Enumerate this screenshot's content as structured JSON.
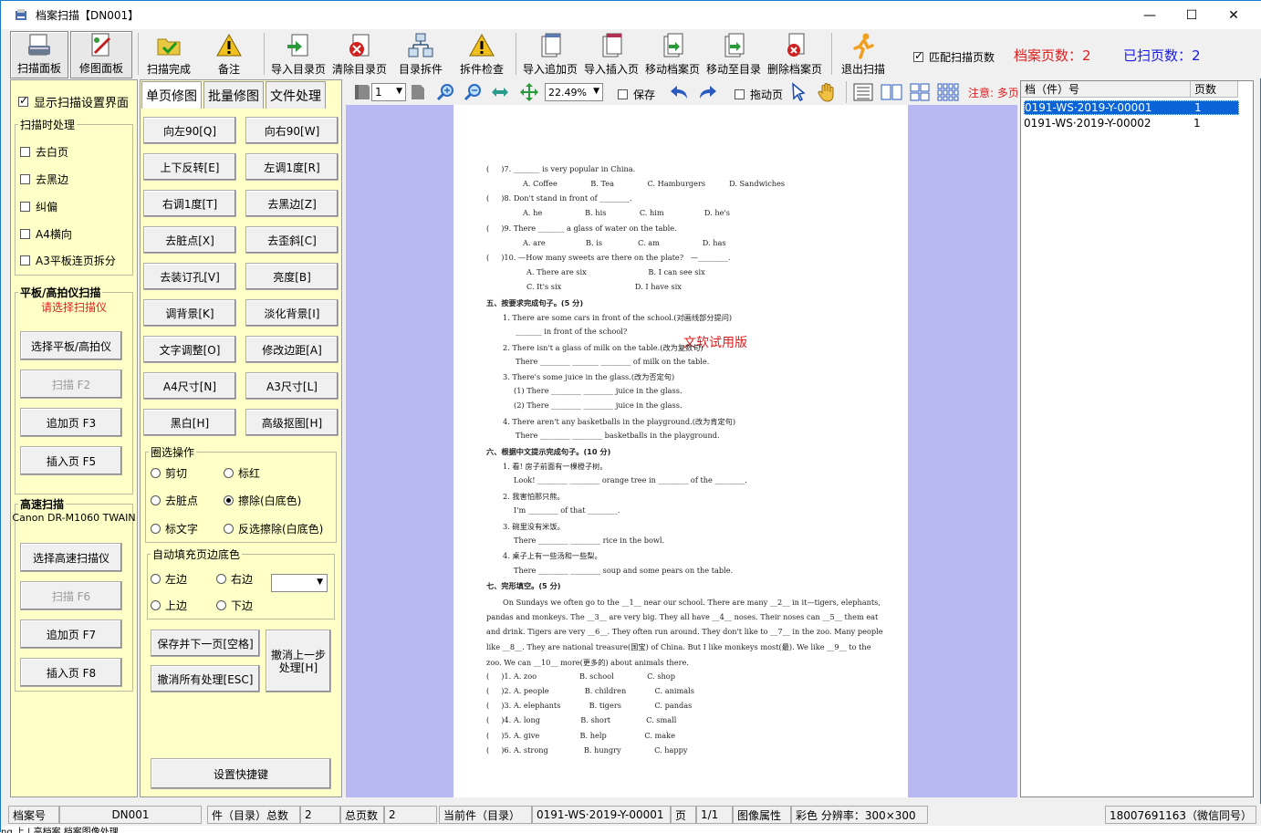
{
  "window": {
    "title": "档案扫描【DN001】",
    "minimize": "—",
    "maximize": "☐",
    "close": "✕"
  },
  "toolbar": {
    "buttons": [
      {
        "label": "扫描面板",
        "icon": "scanner-icon"
      },
      {
        "label": "修图面板",
        "icon": "edit-image-icon"
      },
      {
        "label": "扫描完成",
        "icon": "folder-check-icon"
      },
      {
        "label": "备注",
        "icon": "warning-icon"
      },
      {
        "label": "导入目录页",
        "icon": "import-page-icon"
      },
      {
        "label": "清除目录页",
        "icon": "clear-page-icon"
      },
      {
        "label": "目录拆件",
        "icon": "split-tree-icon"
      },
      {
        "label": "拆件检查",
        "icon": "warning-icon"
      },
      {
        "label": "导入追加页",
        "icon": "import-append-icon"
      },
      {
        "label": "导入插入页",
        "icon": "import-insert-icon"
      },
      {
        "label": "移动档案页",
        "icon": "move-page-icon"
      },
      {
        "label": "移动至目录",
        "icon": "move-to-dir-icon"
      },
      {
        "label": "删除档案页",
        "icon": "delete-page-icon"
      },
      {
        "label": "退出扫描",
        "icon": "exit-runner-icon"
      }
    ],
    "match_pages_label": "匹配扫描页数",
    "match_pages_checked": true,
    "archive_pages": "档案页数：2",
    "scanned_pages": "已扫页数：2",
    "colors": {
      "red": "#e02020",
      "blue": "#1a1ae0"
    }
  },
  "left_panel": {
    "show_settings_label": "显示扫描设置界面",
    "show_settings_checked": true,
    "scan_process_title": "扫描时处理",
    "scan_process_options": [
      {
        "label": "去白页",
        "checked": false
      },
      {
        "label": "去黑边",
        "checked": false
      },
      {
        "label": "纠偏",
        "checked": false
      },
      {
        "label": "A4横向",
        "checked": false
      },
      {
        "label": "A3平板连页拆分",
        "checked": false
      }
    ],
    "flatbed_title": "平板/高拍仪扫描",
    "flatbed_hint": "请选择扫描仪",
    "select_flatbed": "选择平板/高拍仪",
    "scan_f2": "扫描 F2",
    "append_f3": "追加页 F3",
    "insert_f5": "插入页 F5",
    "highspeed_title": "高速扫描",
    "highspeed_device": "Canon DR-M1060 TWAIN",
    "select_highspeed": "选择高速扫描仪",
    "scan_f6": "扫描 F6",
    "append_f7": "追加页 F7",
    "insert_f8": "插入页 F8"
  },
  "mid_panel": {
    "tabs": [
      "单页修图",
      "批量修图",
      "文件处理"
    ],
    "edit_buttons": [
      "向左90[Q]",
      "向右90[W]",
      "上下反转[E]",
      "左调1度[R]",
      "右调1度[T]",
      "去黑边[Z]",
      "去脏点[X]",
      "去歪斜[C]",
      "去装订孔[V]",
      "亮度[B]",
      "调背景[K]",
      "淡化背景[I]",
      "文字调整[O]",
      "修改边距[A]",
      "A4尺寸[N]",
      "A3尺寸[L]",
      "黑白[H]",
      "高级抠图[H]"
    ],
    "select_ops_title": "圈选操作",
    "select_ops": [
      {
        "label": "剪切",
        "checked": false
      },
      {
        "label": "标红",
        "checked": false
      },
      {
        "label": "去脏点",
        "checked": false
      },
      {
        "label": "擦除(白底色)",
        "checked": true
      },
      {
        "label": "标文字",
        "checked": false
      },
      {
        "label": "反选擦除(白底色)",
        "checked": false
      }
    ],
    "autofill_title": "自动填充页边底色",
    "autofill": [
      "左边",
      "右边",
      "上边",
      "下边"
    ],
    "save_next": "保存并下一页[空格]",
    "undo_all": "撤消所有处理[ESC]",
    "undo_prev": "撤消上一步处理[H]",
    "shortcut_settings": "设置快捷键"
  },
  "viewbar": {
    "page_select": "1",
    "zoom": "22.49%",
    "save_label": "保存",
    "drag_label": "拖动页",
    "notice": "注意: 多页"
  },
  "document": {
    "watermark": "文软试用版",
    "lines": [
      "(     )7. _______ is very popular in China.",
      "A. Coffee              B. Tea              C. Hamburgers          D. Sandwiches",
      "(     )8. Don't stand in front of ________.",
      "A. he                  B. his              C. him                 D. he's",
      "(     )9. There _______ a glass of water on the table.",
      "A. are                 B. is               C. am                  D. has",
      "(     )10. —How many sweets are there on the plate?   —________.",
      "A. There are six                          B. I can see six",
      "C. It's six                               D. I have six",
      "五、按要求完成句子。(5 分)",
      "1. There are some cars in front of the school.(对画线部分提问)",
      "_______ in front of the school?",
      "2. There isn't a glass of milk on the table.(改为复数句)",
      "There ________ _______ ________ of milk on the table.",
      "3. There's some juice in the glass.(改为否定句)",
      "(1) There ________ ________ juice in the glass.",
      "(2) There ________ ________ juice in the glass.",
      "4. There aren't any basketballs in the playground.(改为肯定句)",
      "There ________ ________ basketballs in the playground.",
      "六、根据中文提示完成句子。(10 分)",
      "1. 看! 房子前面有一棵橙子树。",
      "Look! ________ ________ orange tree in ________ of the ________.",
      "2. 我害怕那只熊。",
      "I'm ________ of that ________.",
      "3. 碗里没有米饭。",
      "There ________ ________ rice in the bowl.",
      "4. 桌子上有一些汤和一些梨。",
      "There ________ ________ soup and some pears on the table.",
      "七、完形填空。(5 分)",
      "On Sundays we often go to the __1__ near our school. There are many __2__ in it—tigers, elephants,",
      "pandas and monkeys. The __3__ are very big. They all have __4__ noses. Their noses can __5__ them eat",
      "and drink. Tigers are very __6__. They often run around. They don't like to __7__ in the zoo. Many people",
      "like __8__. They are national treasure(国宝) of China. But I like monkeys most(最). We like __9__ to the",
      "zoo. We can __10__ more(更多的) about animals there.",
      "(     )1. A. zoo                  B. school              C. shop",
      "(     )2. A. people               B. children            C. animals",
      "(     )3. A. elephants            B. tigers              C. pandas",
      "(     )4. A. long                 B. short               C. small",
      "(     )5. A. give                 B. help                C. make",
      "(     )6. A. strong               B. hungry              C. happy"
    ]
  },
  "file_list": {
    "headers": [
      "档（件）号",
      "页数"
    ],
    "rows": [
      {
        "id": "0191-WS·2019-Y-00001",
        "pages": "1",
        "selected": true
      },
      {
        "id": "0191-WS·2019-Y-00002",
        "pages": "1",
        "selected": false
      }
    ]
  },
  "status": {
    "archive_no_label": "档案号",
    "archive_no": "DN001",
    "total_items_label": "件（目录）总数",
    "total_items": "2",
    "total_pages_label": "总页数",
    "total_pages": "2",
    "current_label": "当前件（目录）",
    "current": "0191-WS·2019-Y-00001",
    "page_label": "页",
    "page": "1/1",
    "image_props_label": "图像属性",
    "image_props": "彩色 分辨率：300×300",
    "contact": "18007691163（微信同号）"
  },
  "bottom_text": "ng 上 | 高档案 档案图像处理"
}
